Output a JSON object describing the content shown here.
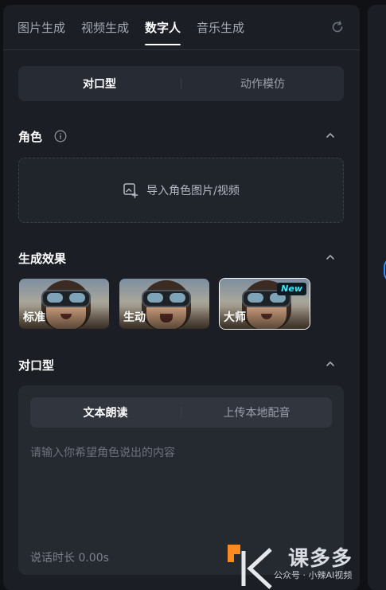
{
  "tabs": [
    {
      "label": "图片生成",
      "active": false
    },
    {
      "label": "视频生成",
      "active": false
    },
    {
      "label": "数字人",
      "active": true
    },
    {
      "label": "音乐生成",
      "active": false
    }
  ],
  "mode_segment": {
    "items": [
      "对口型",
      "动作模仿"
    ],
    "selected": "对口型"
  },
  "role_section": {
    "title": "角色",
    "upload_label": "导入角色图片/视频"
  },
  "effect_section": {
    "title": "生成效果",
    "options": [
      {
        "label": "标准",
        "badge": ""
      },
      {
        "label": "生动",
        "badge": ""
      },
      {
        "label": "大师",
        "badge": "New",
        "selected": true
      }
    ]
  },
  "lipsync_section": {
    "title": "对口型",
    "segment": {
      "items": [
        "文本朗读",
        "上传本地配音"
      ],
      "selected": "文本朗读"
    },
    "textarea_placeholder": "请输入你希望角色说出的内容",
    "duration_label": "说话时长 0.00s"
  },
  "watermark": {
    "brand": "课多多",
    "caption": "公众号 · 小辣AI视频"
  },
  "colors": {
    "background": "#0f1115",
    "panel": "#1b1e24",
    "badge_text": "#3fe6ff",
    "watermark_accent": "#ff8a1f"
  }
}
